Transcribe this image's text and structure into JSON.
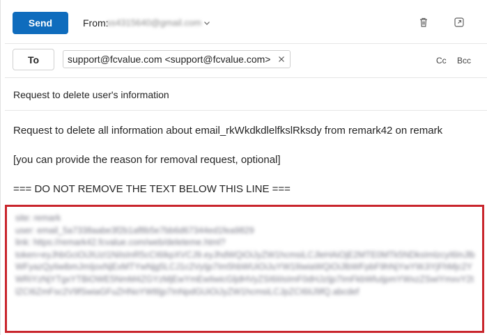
{
  "toolbar": {
    "send_label": "Send",
    "from_label": "From:",
    "from_value": "ss4315640@gmail.com",
    "icons": [
      "delete-icon",
      "popout-icon",
      "chevron-down-icon"
    ]
  },
  "recipients": {
    "to_label": "To",
    "to_chip": "support@fcvalue.com <support@fcvalue.com>",
    "cc_label": "Cc",
    "bcc_label": "Bcc"
  },
  "subject": "Request to delete user's information",
  "body": {
    "line1": "Request to delete all information about email_rkWkdkdlelfkslRksdy from remark42 on remark",
    "line2": "[you can provide the reason for removal request, optional]",
    "line3": "=== DO NOT REMOVE THE TEXT BELOW THIS LINE ===",
    "redacted": [
      "site: remark",
      "user: email_5a7338aabe3f2b1af8b5e7bb6d67344ed1fea9829",
      "link: https://remark42.fcvalue.com/web/deleteme.html?",
      "token=eyJhbGciOiJIUzI1NiIsInR5cCI6IkpXVCJ9.eyJhdWQiOiJyZW1hcmsiLCJleHAiOjE2MTE0MTk5NDksImlzcyI6InJlbWFyazQyIiwibmJmIjoxNjExMTYwNjg5LCJ1c2VyIjp7Im5hbWUiOiJuYW1lIiwiaWQiOiJlbWFpbF9hNjYwYWJiYjFhMjc2YWRiYzNjYTgxYTBiOWE5NmM4ZGYzMjEwYmEwIiwicGljdHVyZSI6IiIsImF0dHJzIjp7ImFkbWluIjpmYWxzZSwiYmxvY2tlZCI6ZmFsc2V9fSwiaGFuZHNoYWtlIjp7InNpdGUiOiJyZW1hcmsiLCJpZCI6IiJ9fQ.abcdef"
    ]
  },
  "highlight_color": "#c9252c",
  "accent_color": "#0f6cbd"
}
